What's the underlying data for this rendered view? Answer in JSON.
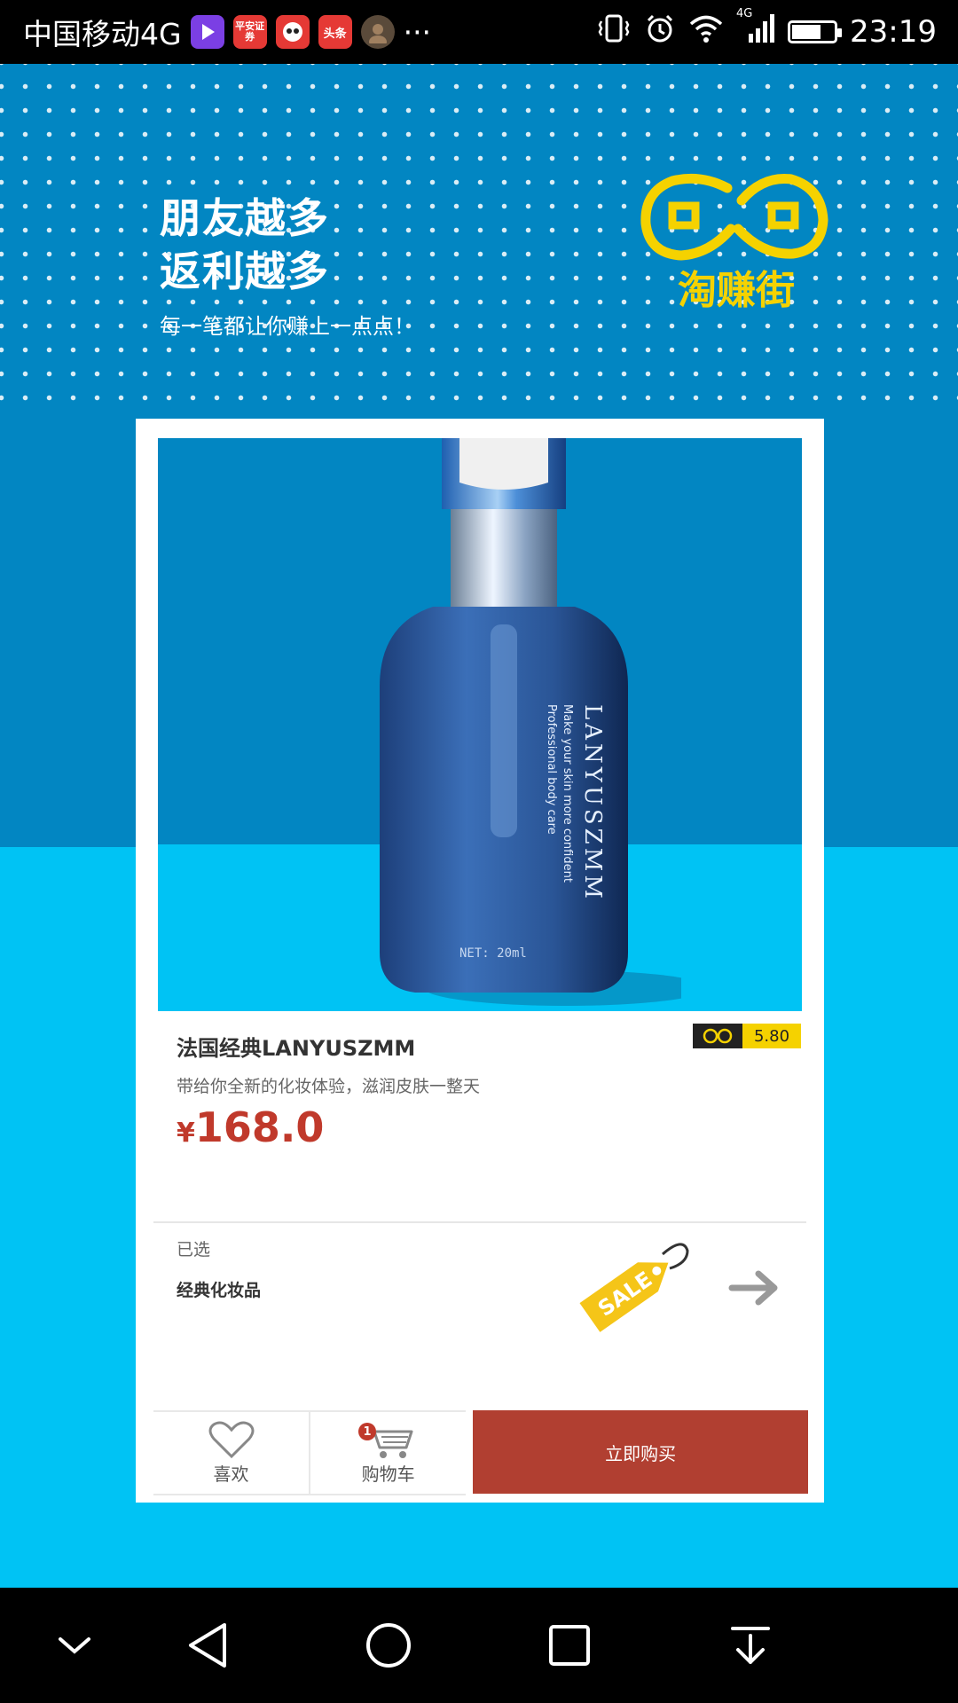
{
  "status_bar": {
    "carrier": "中国移动4G",
    "apps": [
      {
        "name": "video-app-icon",
        "label": "",
        "color": "#7b3fe4"
      },
      {
        "name": "pingan-securities-icon",
        "label": "平安证券",
        "color": "#e53935"
      },
      {
        "name": "panda-app-icon",
        "label": "",
        "color": "#e53935"
      },
      {
        "name": "toutiao-icon",
        "label": "头条",
        "color": "#e53935"
      },
      {
        "name": "avatar-app-icon",
        "label": "",
        "color": "#5a4a3a"
      }
    ],
    "more": "···",
    "network": "4G",
    "battery_level": 0.7,
    "time": "23:19"
  },
  "banner": {
    "headline_line1": "朋友越多",
    "headline_line2": "返利越多",
    "subline": "每一笔都让你赚上一点点！",
    "logo_text": "淘赚街",
    "logo_color": "#f5d200"
  },
  "product": {
    "bottle_brand": "LANYUSZMM",
    "bottle_line1": "Make your skin more confident",
    "bottle_line2": "Professional body care",
    "bottle_volume": "NET: 20ml",
    "rebate": "5.80",
    "title": "法国经典LANYUSZMM",
    "description": "带给你全新的化妆体验，滋润皮肤一整天",
    "price_symbol": "¥",
    "price": "168.0",
    "selected_label": "已选",
    "selected_value": "经典化妆品",
    "sale_tag": "SALE"
  },
  "actions": {
    "like_label": "喜欢",
    "cart_label": "购物车",
    "cart_badge": "1",
    "buy_label": "立即购买"
  },
  "colors": {
    "bg_dark": "#0286c2",
    "bg_light": "#00c3f4",
    "accent_red": "#b13f31",
    "price_red": "#c0392b",
    "tag_yellow": "#f5d200"
  }
}
